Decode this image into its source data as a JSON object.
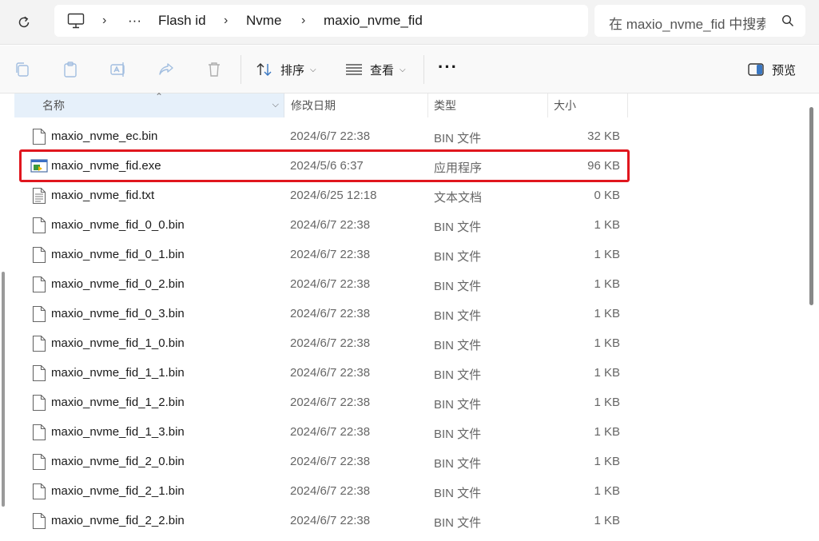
{
  "address_bar": {
    "breadcrumb": [
      "Flash id",
      "Nvme",
      "maxio_nvme_fid"
    ],
    "overflow": "···",
    "search_placeholder": "在 maxio_nvme_fid 中搜索"
  },
  "toolbar": {
    "sort_label": "排序",
    "view_label": "查看",
    "more_label": "···",
    "preview_label": "预览"
  },
  "columns": {
    "name": "名称",
    "date": "修改日期",
    "type": "类型",
    "size": "大小"
  },
  "files": [
    {
      "name": "maxio_nvme_ec.bin",
      "date": "2024/6/7 22:38",
      "type": "BIN 文件",
      "size": "32 KB",
      "icon": "blank-file-icon"
    },
    {
      "name": "maxio_nvme_fid.exe",
      "date": "2024/5/6 6:37",
      "type": "应用程序",
      "size": "96 KB",
      "icon": "application-icon"
    },
    {
      "name": "maxio_nvme_fid.txt",
      "date": "2024/6/25 12:18",
      "type": "文本文档",
      "size": "0 KB",
      "icon": "text-file-icon"
    },
    {
      "name": "maxio_nvme_fid_0_0.bin",
      "date": "2024/6/7 22:38",
      "type": "BIN 文件",
      "size": "1 KB",
      "icon": "blank-file-icon"
    },
    {
      "name": "maxio_nvme_fid_0_1.bin",
      "date": "2024/6/7 22:38",
      "type": "BIN 文件",
      "size": "1 KB",
      "icon": "blank-file-icon"
    },
    {
      "name": "maxio_nvme_fid_0_2.bin",
      "date": "2024/6/7 22:38",
      "type": "BIN 文件",
      "size": "1 KB",
      "icon": "blank-file-icon"
    },
    {
      "name": "maxio_nvme_fid_0_3.bin",
      "date": "2024/6/7 22:38",
      "type": "BIN 文件",
      "size": "1 KB",
      "icon": "blank-file-icon"
    },
    {
      "name": "maxio_nvme_fid_1_0.bin",
      "date": "2024/6/7 22:38",
      "type": "BIN 文件",
      "size": "1 KB",
      "icon": "blank-file-icon"
    },
    {
      "name": "maxio_nvme_fid_1_1.bin",
      "date": "2024/6/7 22:38",
      "type": "BIN 文件",
      "size": "1 KB",
      "icon": "blank-file-icon"
    },
    {
      "name": "maxio_nvme_fid_1_2.bin",
      "date": "2024/6/7 22:38",
      "type": "BIN 文件",
      "size": "1 KB",
      "icon": "blank-file-icon"
    },
    {
      "name": "maxio_nvme_fid_1_3.bin",
      "date": "2024/6/7 22:38",
      "type": "BIN 文件",
      "size": "1 KB",
      "icon": "blank-file-icon"
    },
    {
      "name": "maxio_nvme_fid_2_0.bin",
      "date": "2024/6/7 22:38",
      "type": "BIN 文件",
      "size": "1 KB",
      "icon": "blank-file-icon"
    },
    {
      "name": "maxio_nvme_fid_2_1.bin",
      "date": "2024/6/7 22:38",
      "type": "BIN 文件",
      "size": "1 KB",
      "icon": "blank-file-icon"
    },
    {
      "name": "maxio_nvme_fid_2_2.bin",
      "date": "2024/6/7 22:38",
      "type": "BIN 文件",
      "size": "1 KB",
      "icon": "blank-file-icon"
    }
  ],
  "highlighted_file": "maxio_nvme_fid.exe",
  "colors": {
    "highlight_border": "#e0161e",
    "column_header_active": "#e6f0fa"
  }
}
